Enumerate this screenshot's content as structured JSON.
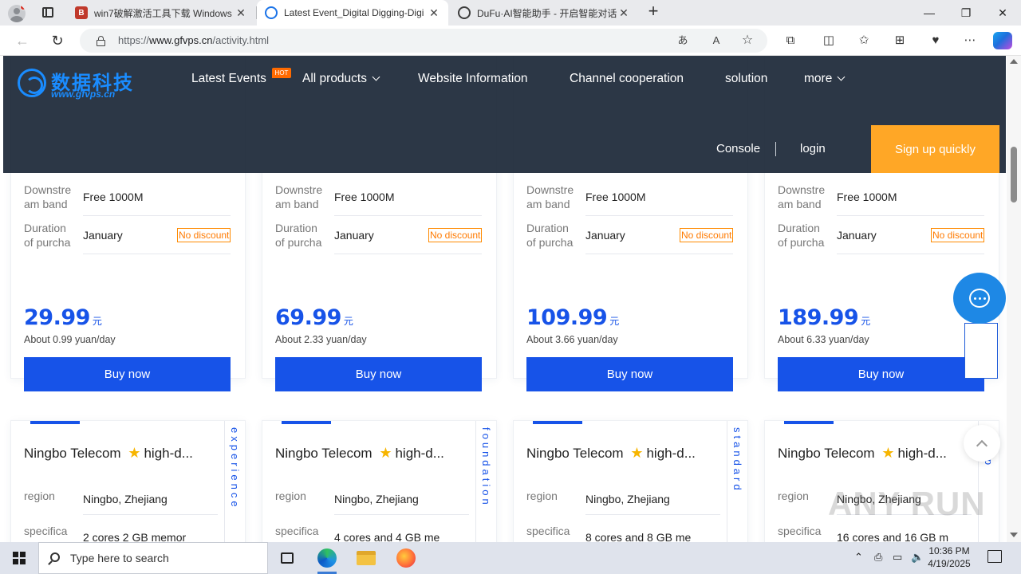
{
  "browser": {
    "tabs": [
      {
        "title": "win7破解激活工具下载 Windows",
        "favicon_color": "#c0392b",
        "favicon_glyph": "B"
      },
      {
        "title": "Latest Event_Digital Digging-Digi",
        "favicon_color": "#1a73e8",
        "favicon_glyph": ""
      },
      {
        "title": "DuFu·AI智能助手 - 开启智能对话",
        "favicon_color": "#3c3c3c",
        "favicon_glyph": ""
      }
    ],
    "url_prefix": "https://",
    "url_host": "www.gfvps.cn",
    "url_path": "/activity.html",
    "toolbar_icons": [
      "translate-icon",
      "read-aloud-icon",
      "favorite-star-icon",
      "extensions-icon",
      "split-screen-icon",
      "favorites-icon",
      "collections-icon",
      "performance-icon",
      "more-icon",
      "copilot-icon"
    ]
  },
  "site": {
    "logo_text": "数据科技",
    "logo_sub": "www.gfvps.cn",
    "nav": {
      "latest_events": "Latest Events",
      "hot": "HOT",
      "all_products": "All products",
      "website_information": "Website Information",
      "channel_cooperation": "Channel cooperation",
      "solution": "solution",
      "more": "more"
    },
    "console": "Console",
    "login": "login",
    "signup": "Sign up quickly"
  },
  "plans": [
    {
      "downstream_label": "Downstream bandwidth",
      "downstream": "Free 1000M",
      "duration_label": "Duration of purchase",
      "duration": "January",
      "discount": "No discount",
      "price": "29.99",
      "unit": "元",
      "per_day": "About 0.99 yuan/day",
      "buy": "Buy now"
    },
    {
      "downstream_label": "Downstream bandwidth",
      "downstream": "Free 1000M",
      "duration_label": "Duration of purchase",
      "duration": "January",
      "discount": "No discount",
      "price": "69.99",
      "unit": "元",
      "per_day": "About 2.33 yuan/day",
      "buy": "Buy now"
    },
    {
      "downstream_label": "Downstream bandwidth",
      "downstream": "Free 1000M",
      "duration_label": "Duration of purchase",
      "duration": "January",
      "discount": "No discount",
      "price": "109.99",
      "unit": "元",
      "per_day": "About 3.66 yuan/day",
      "buy": "Buy now"
    },
    {
      "downstream_label": "Downstream bandwidth",
      "downstream": "Free 1000M",
      "duration_label": "Duration of purchase",
      "duration": "January",
      "discount": "No discount",
      "price": "189.99",
      "unit": "元",
      "per_day": "About 6.33 yuan/day",
      "buy": "Buy now"
    }
  ],
  "products": [
    {
      "tag": "experience",
      "title": "Ningbo Telecom ⭐ high-d...",
      "region_label": "region",
      "region": "Ningbo, Zhejiang",
      "spec_label": "specifica",
      "spec": "2 cores 2 GB memor"
    },
    {
      "tag": "foundation",
      "title": "Ningbo Telecom ⭐ high-d...",
      "region_label": "region",
      "region": "Ningbo, Zhejiang",
      "spec_label": "specifica",
      "spec": "4 cores and 4 GB me"
    },
    {
      "tag": "standard",
      "title": "Ningbo Telecom ⭐ high-d...",
      "region_label": "region",
      "region": "Ningbo, Zhejiang",
      "spec_label": "specifica",
      "spec": "8 cores and 8 GB me"
    },
    {
      "tag": "gship",
      "title": "Ningbo Telecom ⭐ high-d...",
      "region_label": "region",
      "region": "Ningbo, Zhejiang",
      "spec_label": "specifica",
      "spec": "16 cores and 16 GB m"
    }
  ],
  "watermark": "ANY RUN",
  "taskbar": {
    "search_placeholder": "Type here to search",
    "time": "10:36 PM",
    "date": "4/19/2025"
  }
}
